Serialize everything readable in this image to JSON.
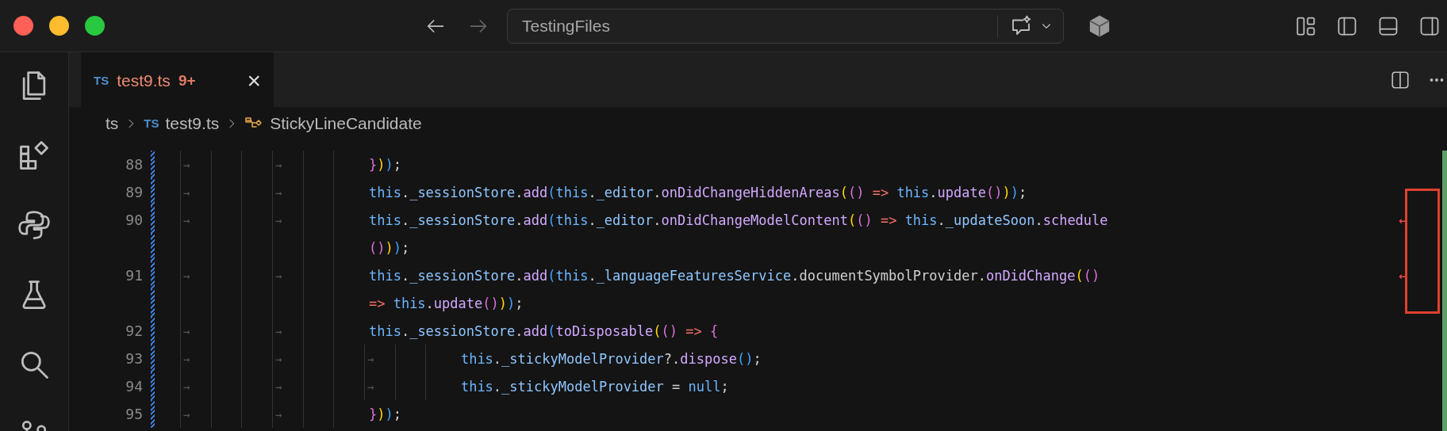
{
  "command_center": {
    "label": "TestingFiles"
  },
  "tabs": [
    {
      "language_badge": "TS",
      "label": "test9.ts",
      "problems": "9+",
      "close": "×",
      "selected": true
    }
  ],
  "breadcrumbs": [
    {
      "kind": "folder",
      "label": "ts"
    },
    {
      "kind": "file",
      "badge": "TS",
      "label": "test9.ts"
    },
    {
      "kind": "symbol",
      "label": "StickyLineCandidate"
    }
  ],
  "editor": {
    "lines": [
      {
        "number": "88",
        "indent": [
          {
            "kind": "tab",
            "text": "→"
          },
          {
            "kind": "space"
          },
          {
            "kind": "space"
          },
          {
            "kind": "tab",
            "text": "→"
          },
          {
            "kind": "space"
          },
          {
            "kind": "space"
          }
        ],
        "tokens": [
          {
            "kind": "bracket2",
            "text": "}"
          },
          {
            "kind": "bracket1",
            "text": ")"
          },
          {
            "kind": "bracket3",
            "text": ")"
          },
          {
            "kind": "plain",
            "text": ";"
          }
        ]
      },
      {
        "number": "89",
        "indent": [
          {
            "kind": "tab",
            "text": "→"
          },
          {
            "kind": "space"
          },
          {
            "kind": "space"
          },
          {
            "kind": "tab",
            "text": "→"
          },
          {
            "kind": "space"
          },
          {
            "kind": "space"
          }
        ],
        "tokens": [
          {
            "kind": "keyword",
            "text": "this"
          },
          {
            "kind": "plain",
            "text": "."
          },
          {
            "kind": "property",
            "text": "_sessionStore"
          },
          {
            "kind": "plain",
            "text": "."
          },
          {
            "kind": "method",
            "text": "add"
          },
          {
            "kind": "bracket3",
            "text": "("
          },
          {
            "kind": "keyword",
            "text": "this"
          },
          {
            "kind": "plain",
            "text": "."
          },
          {
            "kind": "property",
            "text": "_editor"
          },
          {
            "kind": "plain",
            "text": "."
          },
          {
            "kind": "method",
            "text": "onDidChangeHiddenAreas"
          },
          {
            "kind": "bracket1",
            "text": "("
          },
          {
            "kind": "bracket2",
            "text": "()"
          },
          {
            "kind": "operator",
            "text": " => "
          },
          {
            "kind": "keyword",
            "text": "this"
          },
          {
            "kind": "plain",
            "text": "."
          },
          {
            "kind": "method",
            "text": "update"
          },
          {
            "kind": "bracket2",
            "text": "()"
          },
          {
            "kind": "bracket1",
            "text": ")"
          },
          {
            "kind": "bracket3",
            "text": ")"
          },
          {
            "kind": "plain",
            "text": ";"
          }
        ]
      },
      {
        "number": "90",
        "indent": [
          {
            "kind": "tab",
            "text": "→"
          },
          {
            "kind": "space"
          },
          {
            "kind": "space"
          },
          {
            "kind": "tab",
            "text": "→"
          },
          {
            "kind": "space"
          },
          {
            "kind": "space"
          }
        ],
        "wrap_mark": "↩",
        "tokens": [
          {
            "kind": "keyword",
            "text": "this"
          },
          {
            "kind": "plain",
            "text": "."
          },
          {
            "kind": "property",
            "text": "_sessionStore"
          },
          {
            "kind": "plain",
            "text": "."
          },
          {
            "kind": "method",
            "text": "add"
          },
          {
            "kind": "bracket3",
            "text": "("
          },
          {
            "kind": "keyword",
            "text": "this"
          },
          {
            "kind": "plain",
            "text": "."
          },
          {
            "kind": "property",
            "text": "_editor"
          },
          {
            "kind": "plain",
            "text": "."
          },
          {
            "kind": "method",
            "text": "onDidChangeModelContent"
          },
          {
            "kind": "bracket1",
            "text": "("
          },
          {
            "kind": "bracket2",
            "text": "()"
          },
          {
            "kind": "operator",
            "text": " => "
          },
          {
            "kind": "keyword",
            "text": "this"
          },
          {
            "kind": "plain",
            "text": "."
          },
          {
            "kind": "property",
            "text": "_updateSoon"
          },
          {
            "kind": "plain",
            "text": "."
          },
          {
            "kind": "method",
            "text": "schedule"
          }
        ]
      },
      {
        "indent": [
          {
            "kind": "space"
          },
          {
            "kind": "space"
          },
          {
            "kind": "space"
          },
          {
            "kind": "space"
          },
          {
            "kind": "space"
          },
          {
            "kind": "space"
          }
        ],
        "tokens": [
          {
            "kind": "bracket2",
            "text": "()"
          },
          {
            "kind": "bracket1",
            "text": ")"
          },
          {
            "kind": "bracket3",
            "text": ")"
          },
          {
            "kind": "plain",
            "text": ";"
          }
        ]
      },
      {
        "number": "91",
        "indent": [
          {
            "kind": "tab",
            "text": "→"
          },
          {
            "kind": "space"
          },
          {
            "kind": "space"
          },
          {
            "kind": "tab",
            "text": "→"
          },
          {
            "kind": "space"
          },
          {
            "kind": "space"
          }
        ],
        "wrap_mark": "↩",
        "tokens": [
          {
            "kind": "keyword",
            "text": "this"
          },
          {
            "kind": "plain",
            "text": "."
          },
          {
            "kind": "property",
            "text": "_sessionStore"
          },
          {
            "kind": "plain",
            "text": "."
          },
          {
            "kind": "method",
            "text": "add"
          },
          {
            "kind": "bracket3",
            "text": "("
          },
          {
            "kind": "keyword",
            "text": "this"
          },
          {
            "kind": "plain",
            "text": "."
          },
          {
            "kind": "property",
            "text": "_languageFeaturesService"
          },
          {
            "kind": "plain",
            "text": ".documentSymbolProvider."
          },
          {
            "kind": "method",
            "text": "onDidChange"
          },
          {
            "kind": "bracket1",
            "text": "("
          },
          {
            "kind": "bracket2",
            "text": "()"
          }
        ]
      },
      {
        "indent": [
          {
            "kind": "space"
          },
          {
            "kind": "space"
          },
          {
            "kind": "space"
          },
          {
            "kind": "space"
          },
          {
            "kind": "space"
          },
          {
            "kind": "space"
          }
        ],
        "tokens": [
          {
            "kind": "operator",
            "text": "=> "
          },
          {
            "kind": "keyword",
            "text": "this"
          },
          {
            "kind": "plain",
            "text": "."
          },
          {
            "kind": "method",
            "text": "update"
          },
          {
            "kind": "bracket2",
            "text": "()"
          },
          {
            "kind": "bracket1",
            "text": ")"
          },
          {
            "kind": "bracket3",
            "text": ")"
          },
          {
            "kind": "plain",
            "text": ";"
          }
        ]
      },
      {
        "number": "92",
        "indent": [
          {
            "kind": "tab",
            "text": "→"
          },
          {
            "kind": "space"
          },
          {
            "kind": "space"
          },
          {
            "kind": "tab",
            "text": "→"
          },
          {
            "kind": "space"
          },
          {
            "kind": "space"
          }
        ],
        "tokens": [
          {
            "kind": "keyword",
            "text": "this"
          },
          {
            "kind": "plain",
            "text": "."
          },
          {
            "kind": "property",
            "text": "_sessionStore"
          },
          {
            "kind": "plain",
            "text": "."
          },
          {
            "kind": "method",
            "text": "add"
          },
          {
            "kind": "bracket3",
            "text": "("
          },
          {
            "kind": "method",
            "text": "toDisposable"
          },
          {
            "kind": "bracket1",
            "text": "("
          },
          {
            "kind": "bracket2",
            "text": "()"
          },
          {
            "kind": "operator",
            "text": " => "
          },
          {
            "kind": "bracket2",
            "text": "{"
          }
        ]
      },
      {
        "number": "93",
        "indent": [
          {
            "kind": "tab",
            "text": "→"
          },
          {
            "kind": "space"
          },
          {
            "kind": "space"
          },
          {
            "kind": "tab",
            "text": "→"
          },
          {
            "kind": "space"
          },
          {
            "kind": "space"
          },
          {
            "kind": "tab",
            "text": "→"
          },
          {
            "kind": "space"
          },
          {
            "kind": "space"
          }
        ],
        "tokens": [
          {
            "kind": "keyword",
            "text": "this"
          },
          {
            "kind": "plain",
            "text": "."
          },
          {
            "kind": "property",
            "text": "_stickyModelProvider"
          },
          {
            "kind": "plain",
            "text": "?."
          },
          {
            "kind": "method",
            "text": "dispose"
          },
          {
            "kind": "bracket3",
            "text": "()"
          },
          {
            "kind": "plain",
            "text": ";"
          }
        ]
      },
      {
        "number": "94",
        "indent": [
          {
            "kind": "tab",
            "text": "→"
          },
          {
            "kind": "space"
          },
          {
            "kind": "space"
          },
          {
            "kind": "tab",
            "text": "→"
          },
          {
            "kind": "space"
          },
          {
            "kind": "space"
          },
          {
            "kind": "tab",
            "text": "→"
          },
          {
            "kind": "space"
          },
          {
            "kind": "space"
          }
        ],
        "tokens": [
          {
            "kind": "keyword",
            "text": "this"
          },
          {
            "kind": "plain",
            "text": "."
          },
          {
            "kind": "property",
            "text": "_stickyModelProvider"
          },
          {
            "kind": "plain",
            "text": " = "
          },
          {
            "kind": "keyword",
            "text": "null"
          },
          {
            "kind": "plain",
            "text": ";"
          }
        ]
      },
      {
        "number": "95",
        "indent": [
          {
            "kind": "tab",
            "text": "→"
          },
          {
            "kind": "space"
          },
          {
            "kind": "space"
          },
          {
            "kind": "tab",
            "text": "→"
          },
          {
            "kind": "space"
          },
          {
            "kind": "space"
          }
        ],
        "tokens": [
          {
            "kind": "bracket2",
            "text": "}"
          },
          {
            "kind": "bracket1",
            "text": ")"
          },
          {
            "kind": "bracket3",
            "text": ")"
          },
          {
            "kind": "plain",
            "text": ";"
          }
        ]
      }
    ]
  }
}
